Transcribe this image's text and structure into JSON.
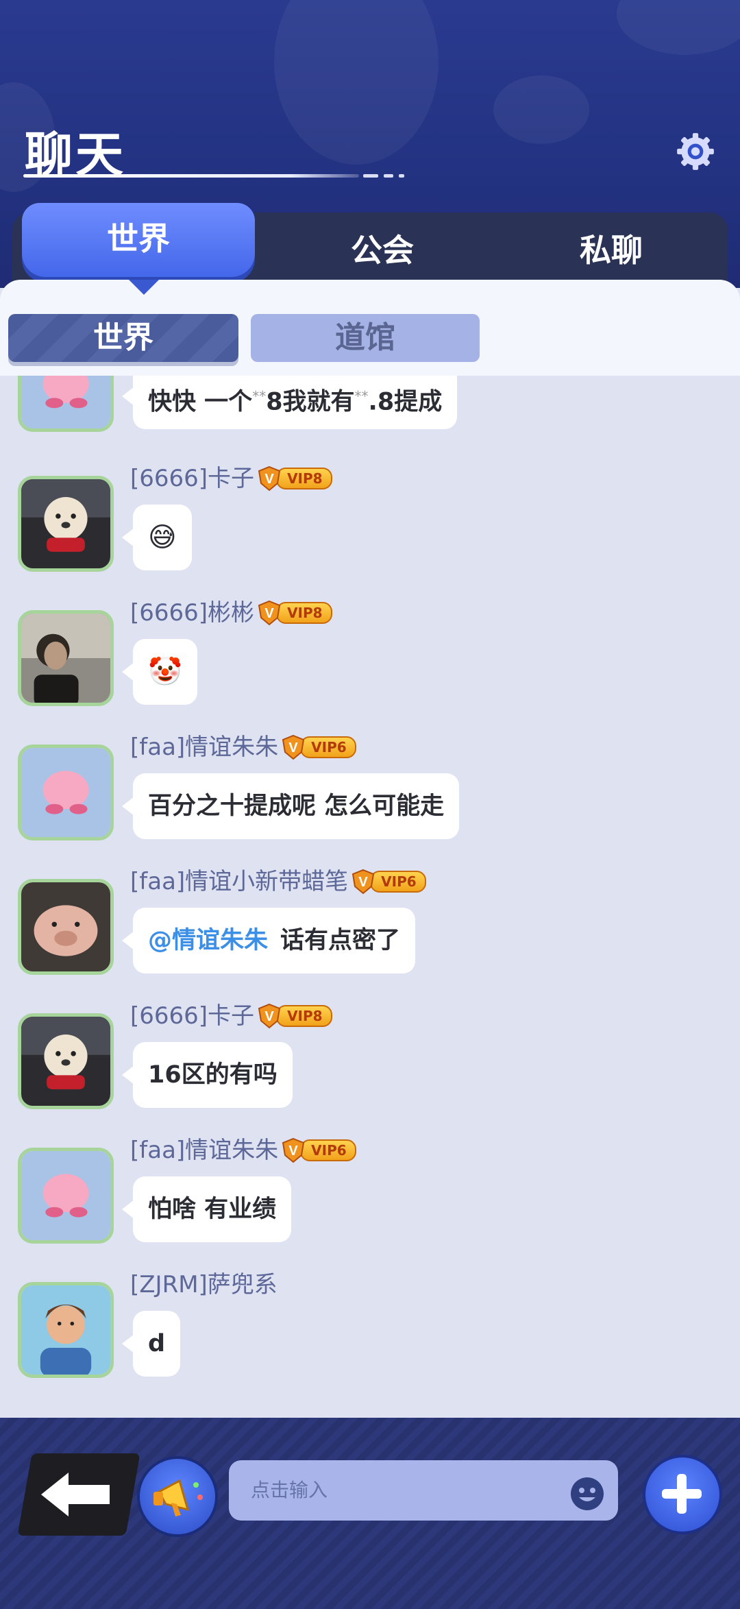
{
  "header": {
    "title": "聊天",
    "settings_icon": "gear-icon"
  },
  "main_tabs": [
    {
      "label": "世界",
      "active": true
    },
    {
      "label": "公会",
      "active": false
    },
    {
      "label": "私聊",
      "active": false
    }
  ],
  "sub_tabs": [
    {
      "label": "世界",
      "active": true
    },
    {
      "label": "道馆",
      "active": false
    }
  ],
  "messages": [
    {
      "avatar": "pink-blob-avatar",
      "text_a": "快快 一个",
      "text_b": "8我就有",
      "text_c": ".8提成",
      "star": "**"
    },
    {
      "name": "[6666]卡子",
      "vip": "VIP8",
      "avatar": "dog-avatar",
      "emoji": "😅"
    },
    {
      "name": "[6666]彬彬",
      "vip": "VIP8",
      "avatar": "man-avatar",
      "emoji": "🤡"
    },
    {
      "name": "[faa]情谊朱朱",
      "vip": "VIP6",
      "avatar": "pink-blob-avatar",
      "text": "百分之十提成呢 怎么可能走"
    },
    {
      "name": "[faa]情谊小新带蜡笔",
      "vip": "VIP6",
      "avatar": "pig-avatar",
      "mention": "@情谊朱朱",
      "text": "话有点密了"
    },
    {
      "name": "[6666]卡子",
      "vip": "VIP8",
      "avatar": "dog-avatar",
      "text": "16区的有吗"
    },
    {
      "name": "[faa]情谊朱朱",
      "vip": "VIP6",
      "avatar": "pink-blob-avatar",
      "text": "怕啥 有业绩"
    },
    {
      "name": "[ZJRM]萨兜系",
      "avatar": "cartoon-boy-avatar",
      "text": "d"
    }
  ],
  "input": {
    "placeholder": "点击输入"
  },
  "colors": {
    "accent": "#4467ea",
    "background": "#dfe3f1",
    "header": "#233281",
    "vip": "#f2a21b"
  }
}
